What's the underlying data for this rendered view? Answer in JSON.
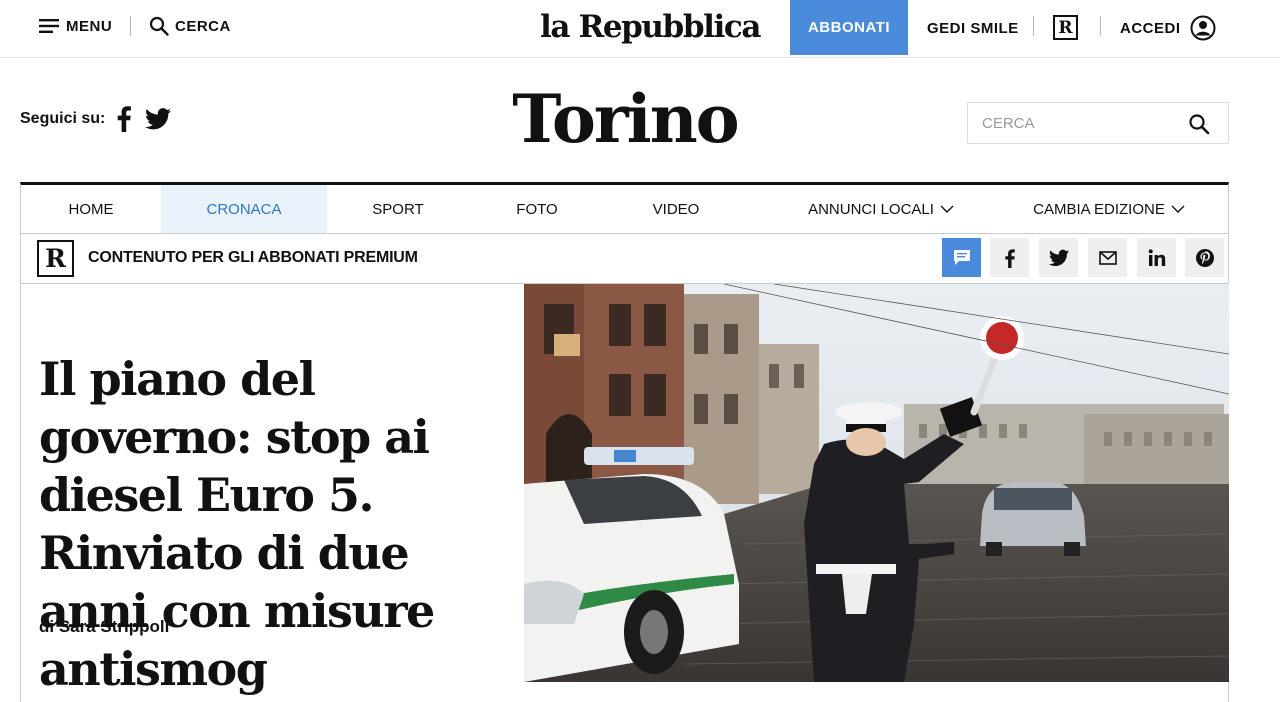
{
  "topbar": {
    "menu_label": "MENU",
    "search_label": "CERCA",
    "logo_text": "la Repubblica",
    "subscribe_label": "ABBONATI",
    "gedi_label": "GEDI SMILE",
    "r_badge": "R",
    "login_label": "ACCEDI"
  },
  "masthead": {
    "follow_label": "Seguici su:",
    "city_title": "Torino",
    "search_placeholder": "CERCA"
  },
  "nav": {
    "items": [
      {
        "label": "HOME"
      },
      {
        "label": "CRONACA",
        "active": true
      },
      {
        "label": "SPORT"
      },
      {
        "label": "FOTO"
      },
      {
        "label": "VIDEO"
      },
      {
        "label": "ANNUNCI LOCALI"
      },
      {
        "label": "CAMBIA EDIZIONE"
      }
    ]
  },
  "premium": {
    "badge": "R",
    "label": "CONTENUTO PER GLI ABBONATI PREMIUM"
  },
  "article": {
    "headline": "Il piano del governo: stop ai diesel Euro 5. Rinviato di due anni con misure antismog",
    "byline": "di Sara Strippoli"
  },
  "colors": {
    "accent": "#4a8bdc",
    "active_nav_bg": "#eaf3fb",
    "active_nav_text": "#2b77c8"
  },
  "icons": [
    "menu-icon",
    "search-icon",
    "user-icon",
    "facebook-icon",
    "twitter-icon",
    "comment-icon",
    "mail-icon",
    "linkedin-icon",
    "pinterest-icon",
    "chevron-down-icon"
  ]
}
